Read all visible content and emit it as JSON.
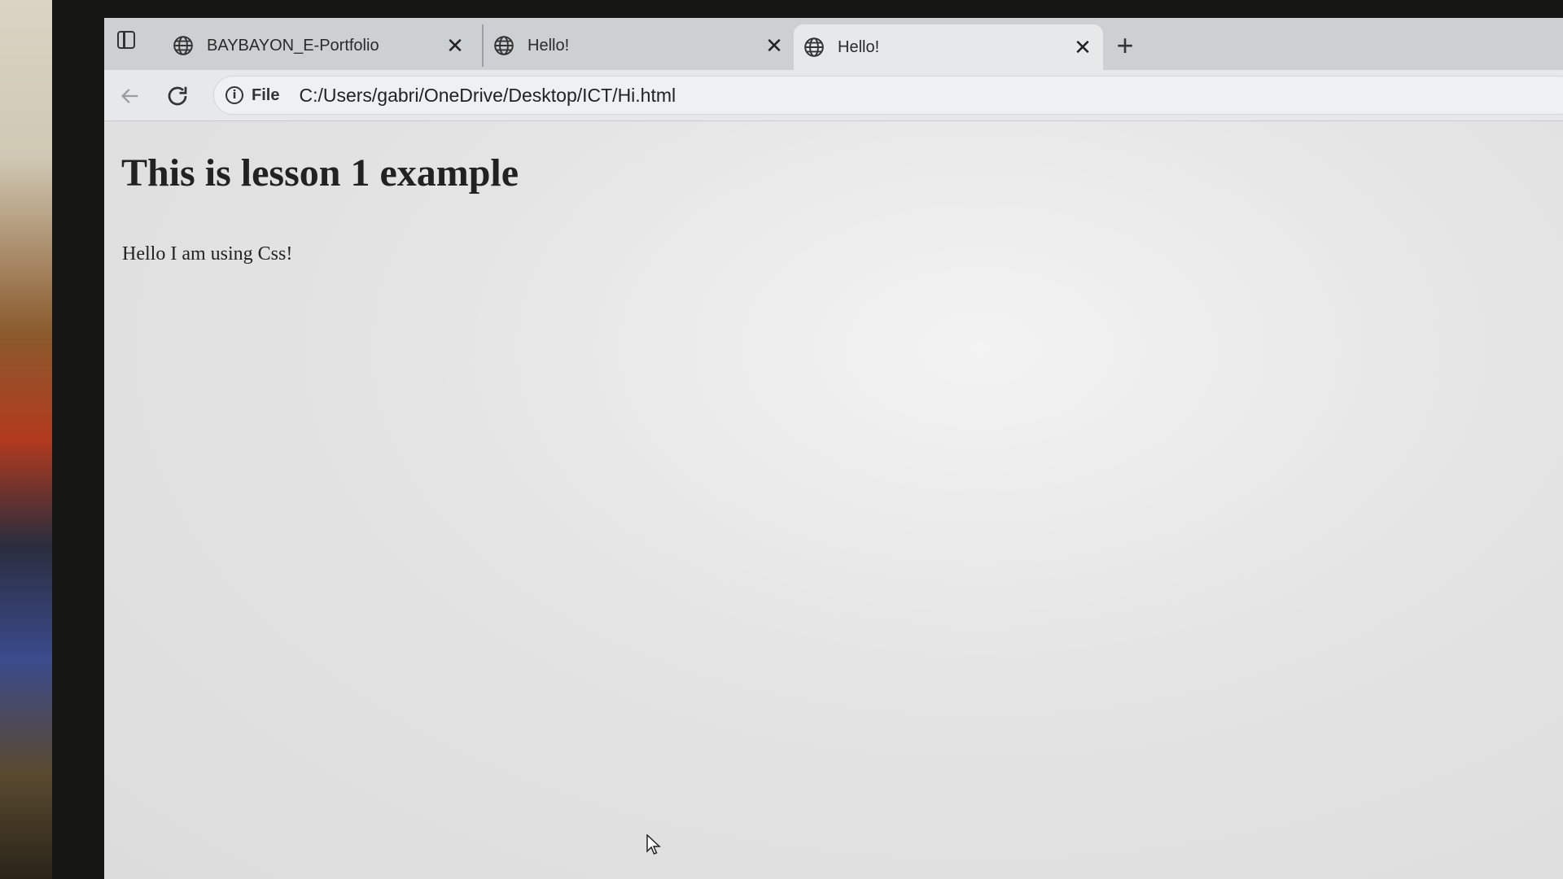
{
  "browser": {
    "tabs": [
      {
        "label": "BAYBAYON_E-Portfolio",
        "icon": "globe-icon",
        "active": false
      },
      {
        "label": "Hello!",
        "icon": "globe-icon",
        "active": false
      },
      {
        "label": "Hello!",
        "icon": "globe-icon",
        "active": true
      }
    ],
    "close_glyph": "✕",
    "new_tab_glyph": "+",
    "address_bar": {
      "info_glyph": "i",
      "scheme_label": "File",
      "url": "C:/Users/gabri/OneDrive/Desktop/ICT/Hi.html"
    }
  },
  "page": {
    "heading": "This is lesson 1 example",
    "paragraph": "Hello I am using Css!"
  }
}
